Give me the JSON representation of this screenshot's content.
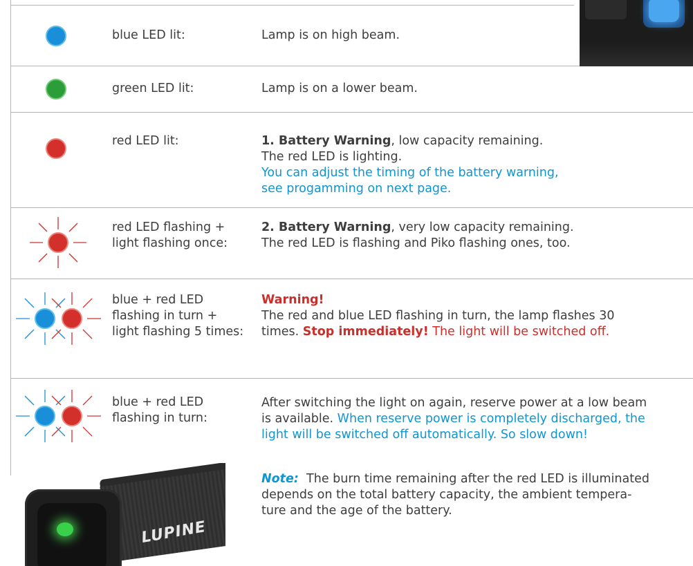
{
  "rows": [
    {
      "label_lines": [
        "blue LED lit:"
      ],
      "desc": "Lamp is on high beam."
    },
    {
      "label_lines": [
        "green LED lit:"
      ],
      "desc": "Lamp is on a lower beam."
    },
    {
      "label_lines": [
        "red LED lit:"
      ],
      "desc_bold": "1. Battery Warning",
      "desc_rest": ", low capacity remaining.",
      "desc_line2": "The red LED is lighting.",
      "desc_blue_1": "You can adjust the timing of the battery warning,",
      "desc_blue_2": "see progamming on next page."
    },
    {
      "label_lines": [
        "red LED flashing +",
        "light flashing once:"
      ],
      "desc_bold": "2. Battery Warning",
      "desc_rest": ", very low capacity remaining.",
      "desc_line2": "The red LED is flashing and Piko flashing ones, too."
    },
    {
      "label_lines": [
        "blue + red LED",
        "flashing in turn +",
        "light flashing 5 times:"
      ],
      "warning_title": "Warning!",
      "desc_line1": "The red and blue LED flashing in turn, the lamp flashes 30",
      "desc_line2_a": "times. ",
      "desc_line2_bold": "Stop immediately!",
      "desc_line2_red": " The light will be switched off."
    },
    {
      "label_lines": [
        "blue + red LED",
        "flashing in turn:"
      ],
      "desc_line1": "After switching the light on again, reserve power at a low beam",
      "desc_line2_a": "is available. ",
      "desc_line2_blue": "When reserve power is completely discharged, the",
      "desc_line3_blue": "light will be switched off automatically. So slow down!"
    }
  ],
  "note": {
    "label": "Note:",
    "line1": "The burn time remaining after the red LED is illuminated",
    "line2": "depends on the total battery capacity, the ambient tempera-",
    "line3": "ture and the age of the battery."
  },
  "product": {
    "brand_logo": "LUPINE"
  },
  "colors": {
    "blue": "#0f95d3",
    "red": "#c9302c",
    "green": "#2b9e3a",
    "text": "#3d3d3d"
  }
}
